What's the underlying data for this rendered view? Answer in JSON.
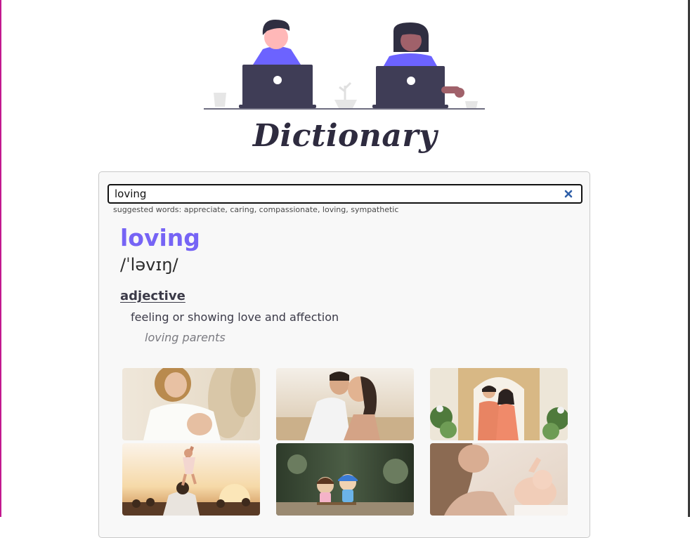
{
  "app": {
    "title": "Dictionary"
  },
  "hero": {
    "illustration": "two-people-with-laptops-illustration"
  },
  "search": {
    "value": "loving",
    "clear_icon": "close-x-icon"
  },
  "suggestions": {
    "text": "suggested words: appreciate, caring, compassionate, loving, sympathetic"
  },
  "entry": {
    "word": "loving",
    "phonetic": "/ˈləvɪŋ/",
    "part_of_speech": "adjective",
    "definition": "feeling or showing love and affection",
    "example": "loving parents"
  },
  "gallery": {
    "images": [
      {
        "subject": "woman-in-white-dress-photo"
      },
      {
        "subject": "couple-kissing-photo"
      },
      {
        "subject": "wedding-couple-photo"
      },
      {
        "subject": "child-lifted-at-sunset-photo"
      },
      {
        "subject": "toy-figurines-photo"
      },
      {
        "subject": "mother-with-baby-photo"
      }
    ]
  },
  "colors": {
    "accent": "#7664f5",
    "text_dark": "#3b3a48",
    "frame_left": "#c2188f"
  }
}
